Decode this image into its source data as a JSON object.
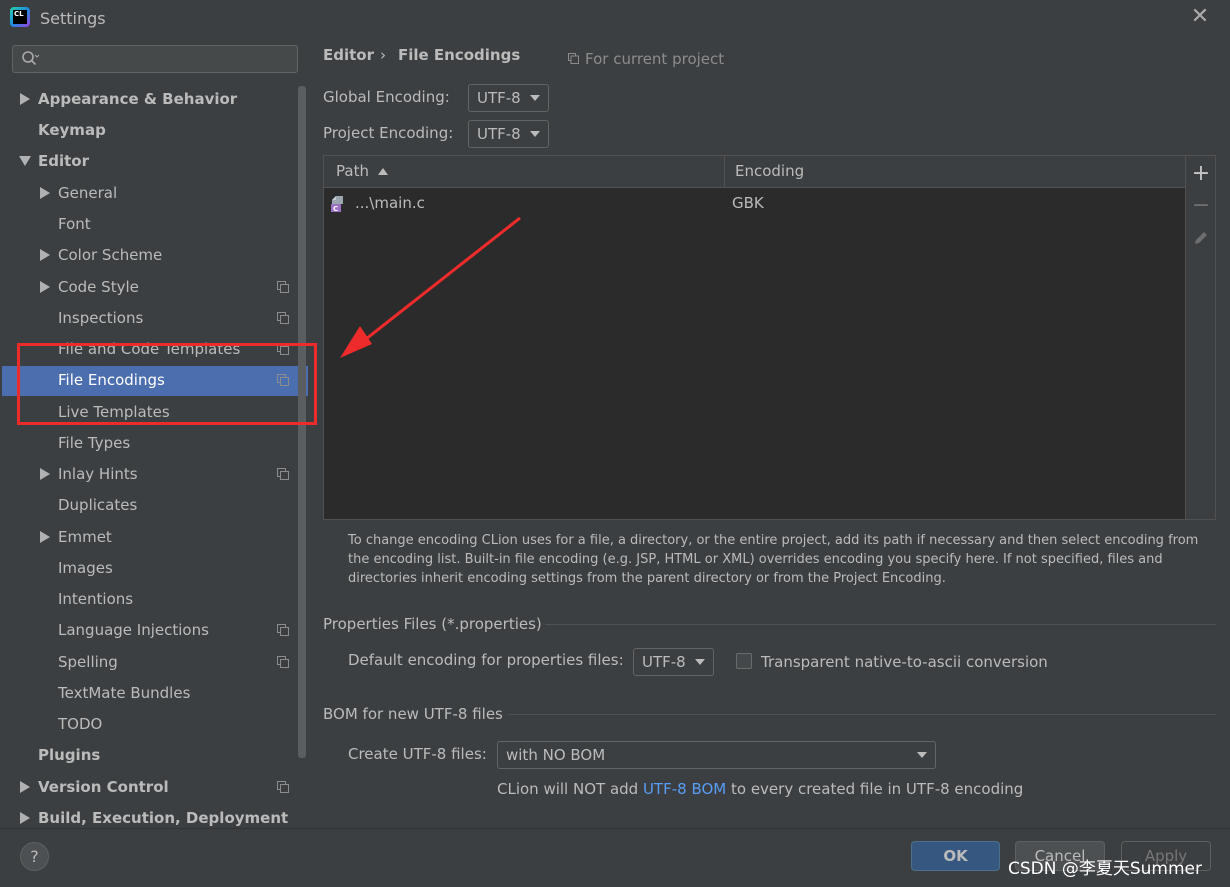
{
  "window": {
    "title": "Settings",
    "app_icon_text": "CL"
  },
  "sidebar": {
    "search": {
      "placeholder": "",
      "value": ""
    },
    "items": [
      {
        "label": "Appearance & Behavior",
        "bold": true,
        "arrow": "right",
        "has_copy_icon": false
      },
      {
        "label": "Keymap",
        "bold": true,
        "arrow": "none",
        "has_copy_icon": false
      },
      {
        "label": "Editor",
        "bold": true,
        "arrow": "down",
        "has_copy_icon": false
      },
      {
        "label": "General",
        "bold": false,
        "arrow": "right",
        "has_copy_icon": false
      },
      {
        "label": "Font",
        "bold": false,
        "arrow": "none",
        "has_copy_icon": false
      },
      {
        "label": "Color Scheme",
        "bold": false,
        "arrow": "right",
        "has_copy_icon": false
      },
      {
        "label": "Code Style",
        "bold": false,
        "arrow": "right",
        "has_copy_icon": true
      },
      {
        "label": "Inspections",
        "bold": false,
        "arrow": "none",
        "has_copy_icon": true
      },
      {
        "label": "File and Code Templates",
        "bold": false,
        "arrow": "none",
        "has_copy_icon": true
      },
      {
        "label": "File Encodings",
        "bold": false,
        "arrow": "none",
        "has_copy_icon": true,
        "selected": true
      },
      {
        "label": "Live Templates",
        "bold": false,
        "arrow": "none",
        "has_copy_icon": false
      },
      {
        "label": "File Types",
        "bold": false,
        "arrow": "none",
        "has_copy_icon": false
      },
      {
        "label": "Inlay Hints",
        "bold": false,
        "arrow": "right",
        "has_copy_icon": true
      },
      {
        "label": "Duplicates",
        "bold": false,
        "arrow": "none",
        "has_copy_icon": false
      },
      {
        "label": "Emmet",
        "bold": false,
        "arrow": "right",
        "has_copy_icon": false
      },
      {
        "label": "Images",
        "bold": false,
        "arrow": "none",
        "has_copy_icon": false
      },
      {
        "label": "Intentions",
        "bold": false,
        "arrow": "none",
        "has_copy_icon": false
      },
      {
        "label": "Language Injections",
        "bold": false,
        "arrow": "none",
        "has_copy_icon": true
      },
      {
        "label": "Spelling",
        "bold": false,
        "arrow": "none",
        "has_copy_icon": true
      },
      {
        "label": "TextMate Bundles",
        "bold": false,
        "arrow": "none",
        "has_copy_icon": false
      },
      {
        "label": "TODO",
        "bold": false,
        "arrow": "none",
        "has_copy_icon": false
      },
      {
        "label": "Plugins",
        "bold": true,
        "arrow": "none",
        "has_copy_icon": false
      },
      {
        "label": "Version Control",
        "bold": true,
        "arrow": "right",
        "has_copy_icon": true
      },
      {
        "label": "Build, Execution, Deployment",
        "bold": true,
        "arrow": "right",
        "has_copy_icon": false
      }
    ]
  },
  "breadcrumb": {
    "parent": "Editor",
    "separator": "›",
    "current": "File Encodings",
    "scope_label": "For current project"
  },
  "encodings": {
    "global_label": "Global Encoding:",
    "global_value": "UTF-8",
    "project_label": "Project Encoding:",
    "project_value": "UTF-8"
  },
  "table": {
    "columns": [
      "Path",
      "Encoding"
    ],
    "rows": [
      {
        "path": "...\\main.c",
        "encoding": "GBK",
        "icon": "c-file-icon"
      }
    ]
  },
  "help_text": "To change encoding CLion uses for a file, a directory, or the entire project, add its path if necessary and then select encoding from the encoding list. Built-in file encoding (e.g. JSP, HTML or XML) overrides encoding you specify here. If not specified, files and directories inherit encoding settings from the parent directory or from the Project Encoding.",
  "properties": {
    "section_title": "Properties Files (*.properties)",
    "default_label": "Default encoding for properties files:",
    "default_value": "UTF-8",
    "transparent_label": "Transparent native-to-ascii conversion",
    "transparent_checked": false
  },
  "bom": {
    "section_title": "BOM for new UTF-8 files",
    "create_label": "Create UTF-8 files:",
    "create_value": "with NO BOM",
    "info_prefix": "CLion will NOT add ",
    "info_link": "UTF-8 BOM",
    "info_suffix": " to every created file in UTF-8 encoding"
  },
  "buttons": {
    "help": "?",
    "ok": "OK",
    "cancel": "Cancel",
    "apply": "Apply"
  },
  "watermark": "CSDN @李夏天Summer",
  "colors": {
    "background": "#3c3f41",
    "selection": "#4b6eaf",
    "annotation_red": "#ee2b2b",
    "link": "#589df6",
    "ok_button": "#365880"
  }
}
